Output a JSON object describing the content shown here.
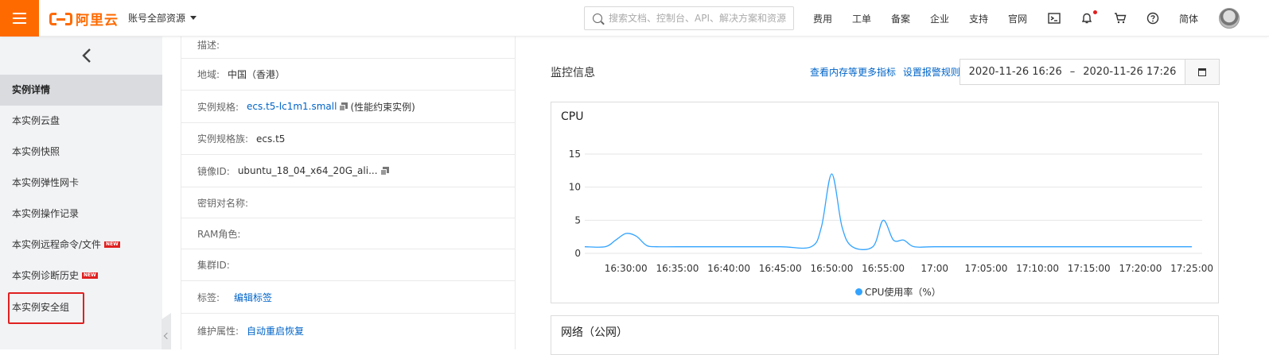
{
  "header": {
    "logo_text": "阿里云",
    "account_scope": "账号全部资源",
    "search_placeholder": "搜索文档、控制台、API、解决方案和资源",
    "nav": [
      "费用",
      "工单",
      "备案",
      "企业",
      "支持",
      "官网"
    ],
    "language": "简体",
    "accent_color": "#ff6a00"
  },
  "sidebar": {
    "items": [
      {
        "label": "实例详情",
        "active": true,
        "new": false
      },
      {
        "label": "本实例云盘",
        "active": false,
        "new": false
      },
      {
        "label": "本实例快照",
        "active": false,
        "new": false
      },
      {
        "label": "本实例弹性网卡",
        "active": false,
        "new": false
      },
      {
        "label": "本实例操作记录",
        "active": false,
        "new": false
      },
      {
        "label": "本实例远程命令/文件",
        "active": false,
        "new": true
      },
      {
        "label": "本实例诊断历史",
        "active": false,
        "new": true
      },
      {
        "label": "本实例安全组",
        "active": false,
        "new": false,
        "highlighted": true
      }
    ],
    "new_badge": "NEW"
  },
  "details": {
    "rows": [
      {
        "label": "描述:",
        "value": ""
      },
      {
        "label": "地域:",
        "value": "中国（香港）"
      },
      {
        "label": "实例规格:",
        "value": "ecs.t5-lc1m1.small",
        "extra": "(性能约束实例)"
      },
      {
        "label": "实例规格族:",
        "value": "ecs.t5"
      },
      {
        "label": "镜像ID:",
        "value": "ubuntu_18_04_x64_20G_ali..."
      },
      {
        "label": "密钥对名称:",
        "value": ""
      },
      {
        "label": "RAM角色:",
        "value": ""
      },
      {
        "label": "集群ID:",
        "value": ""
      },
      {
        "label": "标签:",
        "value": "编辑标签"
      },
      {
        "label": "维护属性:",
        "value": "自动重启恢复"
      }
    ]
  },
  "monitor": {
    "title": "监控信息",
    "link_more": "查看内存等更多指标",
    "link_alarm": "设置报警规则",
    "date_start": "2020-11-26 16:26",
    "date_sep": "–",
    "date_end": "2020-11-26 17:26",
    "network_title": "网络（公网）"
  },
  "chart_data": {
    "type": "line",
    "title": "CPU",
    "x_ticks": [
      "16:30:00",
      "16:35:00",
      "16:40:00",
      "16:45:00",
      "16:50:00",
      "16:55:00",
      "17:00",
      "17:05:00",
      "17:10:00",
      "17:15:00",
      "17:20:00",
      "17:25:00"
    ],
    "y_ticks": [
      0,
      5,
      10,
      15
    ],
    "ylim": [
      0,
      15
    ],
    "grid": true,
    "legend_position": "bottom-center",
    "series": [
      {
        "name": "CPU使用率（%）",
        "color": "#32a3ff",
        "points": [
          [
            "16:26",
            1
          ],
          [
            "16:28",
            1
          ],
          [
            "16:29",
            2
          ],
          [
            "16:30",
            3
          ],
          [
            "16:31",
            2.6
          ],
          [
            "16:32",
            1.2
          ],
          [
            "16:33",
            1
          ],
          [
            "16:35",
            1
          ],
          [
            "16:40",
            1
          ],
          [
            "16:45",
            1
          ],
          [
            "16:48",
            1
          ],
          [
            "16:49",
            4
          ],
          [
            "16:50",
            12
          ],
          [
            "16:51",
            4
          ],
          [
            "16:52",
            1
          ],
          [
            "16:54",
            1
          ],
          [
            "16:55",
            5
          ],
          [
            "16:56",
            2
          ],
          [
            "16:57",
            2
          ],
          [
            "16:58",
            1
          ],
          [
            "17:00",
            1
          ],
          [
            "17:05",
            1
          ],
          [
            "17:10",
            1
          ],
          [
            "17:15",
            1
          ],
          [
            "17:20",
            1
          ],
          [
            "17:25",
            1
          ]
        ]
      }
    ]
  }
}
